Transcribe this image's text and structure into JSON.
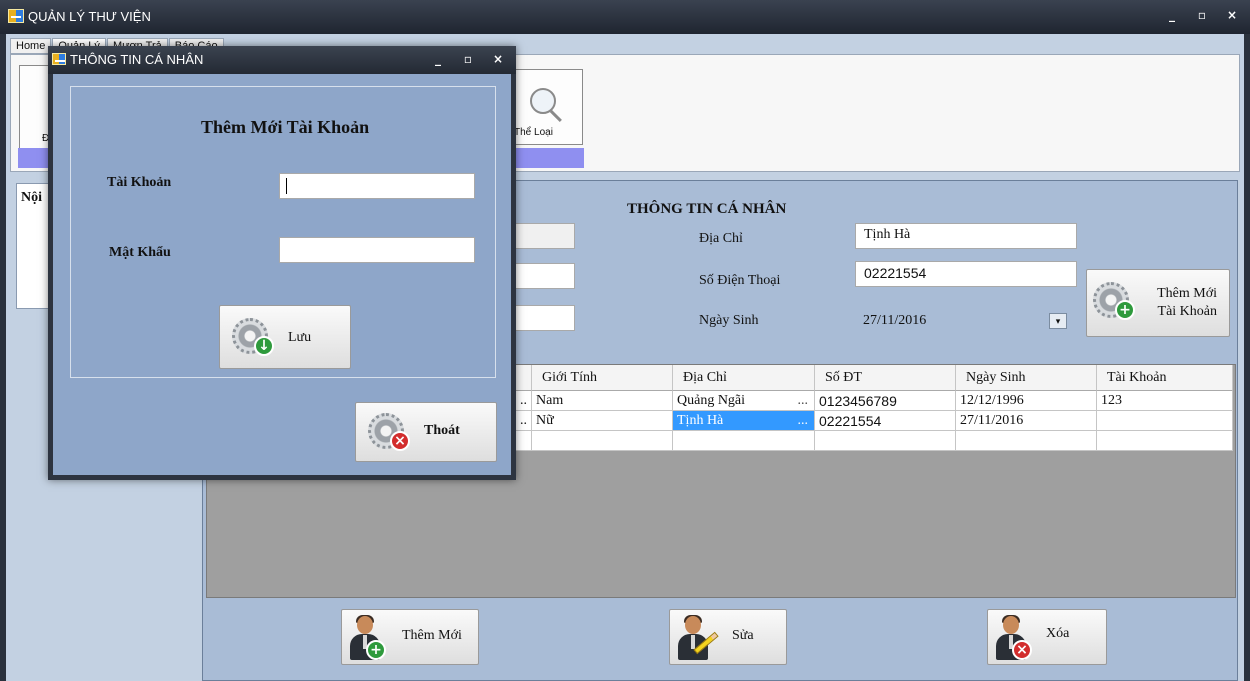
{
  "app": {
    "title": "QUẢN LÝ THƯ VIỆN"
  },
  "tabs": [
    "Home",
    "Quản Lý",
    "Mượn Trả",
    "Báo Cáo"
  ],
  "ribbon": {
    "left_label_partial": "Đô",
    "category_button": "Thể Loại"
  },
  "left_panel": {
    "title_partial": "Nội"
  },
  "window_controls": {
    "minimize": "_",
    "maximize": "▫",
    "close": "×"
  },
  "form": {
    "title": "THÔNG TIN CÁ NHÂN",
    "address_label": "Địa Chỉ",
    "address_value": "Tịnh Hà",
    "phone_label": "Số Điện Thoại",
    "phone_value": "02221554",
    "dob_label": "Ngày Sinh",
    "dob_value": "27/11/2016",
    "dob_dropdown": "▾",
    "add_account_button": [
      "Thêm Mới",
      "Tài Khoản"
    ]
  },
  "grid": {
    "columns": [
      "Giới Tính",
      "Địa Chỉ",
      "Số ĐT",
      "Ngày Sinh",
      "Tài Khoản"
    ],
    "rows": [
      [
        "Nam",
        "Quảng Ngãi",
        "0123456789",
        "12/12/1996",
        "123"
      ],
      [
        "Nữ",
        "Tịnh Hà",
        "02221554",
        "27/11/2016",
        ""
      ]
    ],
    "ellipsis": "...",
    "truncated_marker": ".."
  },
  "bottom_buttons": {
    "add": "Thêm Mới",
    "edit": "Sửa",
    "delete": "Xóa"
  },
  "dialog": {
    "title": "THÔNG TIN CÁ NHÂN",
    "heading": "Thêm Mới Tài Khoản",
    "account_label": "Tài Khoản",
    "account_value": "",
    "password_label": "Mật Khẩu",
    "password_value": "",
    "save_button": "Lưu",
    "exit_button": "Thoát"
  },
  "colors": {
    "selection": "#3399ff",
    "ribbon_bar": "#8f8ff0",
    "dialog_bg": "#8ea6c9"
  }
}
